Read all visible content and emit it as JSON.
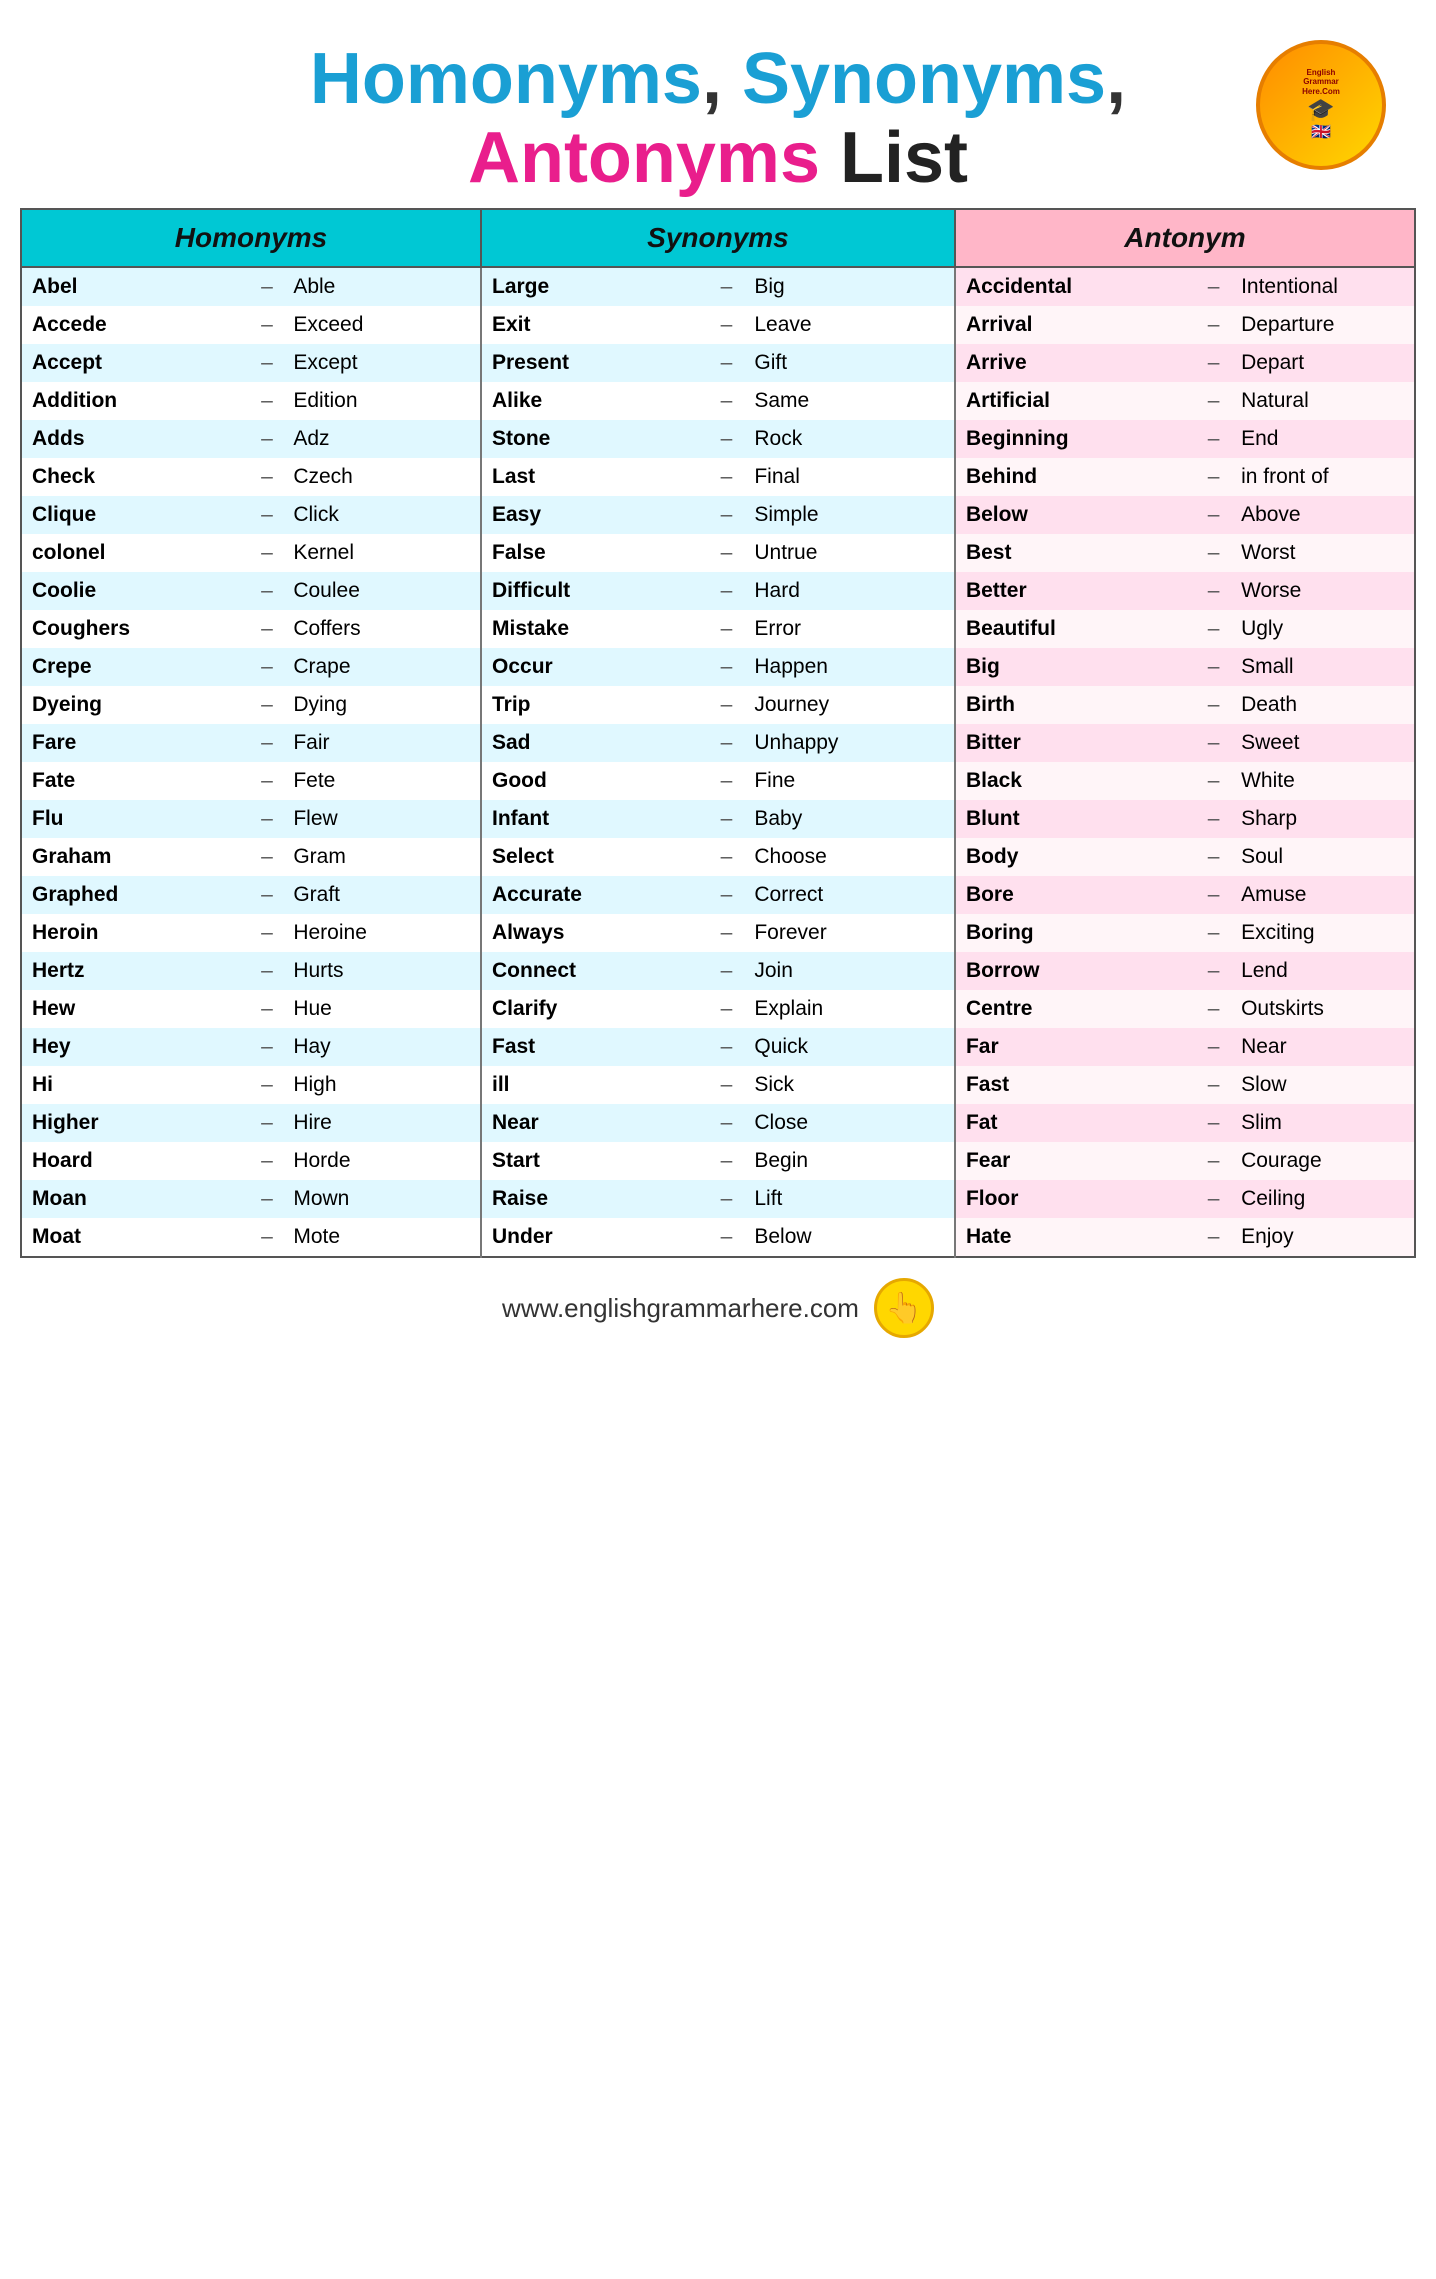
{
  "title": {
    "line1_part1": "Homonyms",
    "line1_comma": ",",
    "line1_part2": " Synonyms",
    "line1_comma2": ",",
    "line2_part1": "Antonyms",
    "line2_part2": " List"
  },
  "logo": {
    "text": "English Grammar Here.Com"
  },
  "headers": {
    "homonyms": "Homonyms",
    "synonyms": "Synonyms",
    "antonyms": "Antonym"
  },
  "rows": [
    {
      "h_word": "Abel",
      "h_dash": "–",
      "h_syn": "Able",
      "s_word": "Large",
      "s_dash": "–",
      "s_syn": "Big",
      "a_word": "Accidental",
      "a_dash": "–",
      "a_syn": "Intentional"
    },
    {
      "h_word": "Accede",
      "h_dash": "–",
      "h_syn": "Exceed",
      "s_word": "Exit",
      "s_dash": "–",
      "s_syn": "Leave",
      "a_word": "Arrival",
      "a_dash": "–",
      "a_syn": "Departure"
    },
    {
      "h_word": "Accept",
      "h_dash": "–",
      "h_syn": "Except",
      "s_word": "Present",
      "s_dash": "–",
      "s_syn": "Gift",
      "a_word": "Arrive",
      "a_dash": "–",
      "a_syn": "Depart"
    },
    {
      "h_word": "Addition",
      "h_dash": "–",
      "h_syn": "Edition",
      "s_word": "Alike",
      "s_dash": "–",
      "s_syn": "Same",
      "a_word": "Artificial",
      "a_dash": "–",
      "a_syn": "Natural"
    },
    {
      "h_word": "Adds",
      "h_dash": "–",
      "h_syn": "Adz",
      "s_word": "Stone",
      "s_dash": "–",
      "s_syn": "Rock",
      "a_word": "Beginning",
      "a_dash": "–",
      "a_syn": "End"
    },
    {
      "h_word": "Check",
      "h_dash": "–",
      "h_syn": "Czech",
      "s_word": "Last",
      "s_dash": "–",
      "s_syn": "Final",
      "a_word": "Behind",
      "a_dash": "–",
      "a_syn": "in front of"
    },
    {
      "h_word": "Clique",
      "h_dash": "–",
      "h_syn": "Click",
      "s_word": "Easy",
      "s_dash": "–",
      "s_syn": "Simple",
      "a_word": "Below",
      "a_dash": "–",
      "a_syn": "Above"
    },
    {
      "h_word": "colonel",
      "h_dash": "–",
      "h_syn": "Kernel",
      "s_word": "False",
      "s_dash": "–",
      "s_syn": "Untrue",
      "a_word": "Best",
      "a_dash": "–",
      "a_syn": "Worst"
    },
    {
      "h_word": "Coolie",
      "h_dash": "–",
      "h_syn": "Coulee",
      "s_word": "Difficult",
      "s_dash": "–",
      "s_syn": "Hard",
      "a_word": "Better",
      "a_dash": "–",
      "a_syn": "Worse"
    },
    {
      "h_word": "Coughers",
      "h_dash": "–",
      "h_syn": "Coffers",
      "s_word": "Mistake",
      "s_dash": "–",
      "s_syn": "Error",
      "a_word": "Beautiful",
      "a_dash": "–",
      "a_syn": "Ugly"
    },
    {
      "h_word": "Crepe",
      "h_dash": "–",
      "h_syn": "Crape",
      "s_word": "Occur",
      "s_dash": "–",
      "s_syn": "Happen",
      "a_word": "Big",
      "a_dash": "–",
      "a_syn": "Small"
    },
    {
      "h_word": "Dyeing",
      "h_dash": "–",
      "h_syn": "Dying",
      "s_word": "Trip",
      "s_dash": "–",
      "s_syn": "Journey",
      "a_word": "Birth",
      "a_dash": "–",
      "a_syn": "Death"
    },
    {
      "h_word": "Fare",
      "h_dash": "–",
      "h_syn": "Fair",
      "s_word": "Sad",
      "s_dash": "–",
      "s_syn": "Unhappy",
      "a_word": "Bitter",
      "a_dash": "–",
      "a_syn": "Sweet"
    },
    {
      "h_word": "Fate",
      "h_dash": "–",
      "h_syn": "Fete",
      "s_word": "Good",
      "s_dash": "–",
      "s_syn": "Fine",
      "a_word": "Black",
      "a_dash": "–",
      "a_syn": "White"
    },
    {
      "h_word": "Flu",
      "h_dash": "–",
      "h_syn": "Flew",
      "s_word": "Infant",
      "s_dash": "–",
      "s_syn": "Baby",
      "a_word": "Blunt",
      "a_dash": "–",
      "a_syn": "Sharp"
    },
    {
      "h_word": "Graham",
      "h_dash": "–",
      "h_syn": "Gram",
      "s_word": "Select",
      "s_dash": "–",
      "s_syn": "Choose",
      "a_word": "Body",
      "a_dash": "–",
      "a_syn": "Soul"
    },
    {
      "h_word": "Graphed",
      "h_dash": "–",
      "h_syn": "Graft",
      "s_word": "Accurate",
      "s_dash": "–",
      "s_syn": "Correct",
      "a_word": "Bore",
      "a_dash": "–",
      "a_syn": "Amuse"
    },
    {
      "h_word": "Heroin",
      "h_dash": "–",
      "h_syn": "Heroine",
      "s_word": "Always",
      "s_dash": "–",
      "s_syn": "Forever",
      "a_word": "Boring",
      "a_dash": "–",
      "a_syn": "Exciting"
    },
    {
      "h_word": "Hertz",
      "h_dash": "–",
      "h_syn": "Hurts",
      "s_word": "Connect",
      "s_dash": "–",
      "s_syn": "Join",
      "a_word": "Borrow",
      "a_dash": "–",
      "a_syn": "Lend"
    },
    {
      "h_word": "Hew",
      "h_dash": "–",
      "h_syn": "Hue",
      "s_word": "Clarify",
      "s_dash": "–",
      "s_syn": "Explain",
      "a_word": "Centre",
      "a_dash": "–",
      "a_syn": "Outskirts"
    },
    {
      "h_word": "Hey",
      "h_dash": "–",
      "h_syn": "Hay",
      "s_word": "Fast",
      "s_dash": "–",
      "s_syn": "Quick",
      "a_word": "Far",
      "a_dash": "–",
      "a_syn": "Near"
    },
    {
      "h_word": "Hi",
      "h_dash": "–",
      "h_syn": "High",
      "s_word": "ill",
      "s_dash": "–",
      "s_syn": "Sick",
      "a_word": "Fast",
      "a_dash": "–",
      "a_syn": "Slow"
    },
    {
      "h_word": "Higher",
      "h_dash": "–",
      "h_syn": "Hire",
      "s_word": "Near",
      "s_dash": "–",
      "s_syn": "Close",
      "a_word": "Fat",
      "a_dash": "–",
      "a_syn": "Slim"
    },
    {
      "h_word": "Hoard",
      "h_dash": "–",
      "h_syn": "Horde",
      "s_word": "Start",
      "s_dash": "–",
      "s_syn": "Begin",
      "a_word": "Fear",
      "a_dash": "–",
      "a_syn": "Courage"
    },
    {
      "h_word": "Moan",
      "h_dash": "–",
      "h_syn": "Mown",
      "s_word": "Raise",
      "s_dash": "–",
      "s_syn": "Lift",
      "a_word": "Floor",
      "a_dash": "–",
      "a_syn": "Ceiling"
    },
    {
      "h_word": "Moat",
      "h_dash": "–",
      "h_syn": "Mote",
      "s_word": "Under",
      "s_dash": "–",
      "s_syn": "Below",
      "a_word": "Hate",
      "a_dash": "–",
      "a_syn": "Enjoy"
    }
  ],
  "footer": {
    "url": "www.englishgrammarhere.com"
  }
}
